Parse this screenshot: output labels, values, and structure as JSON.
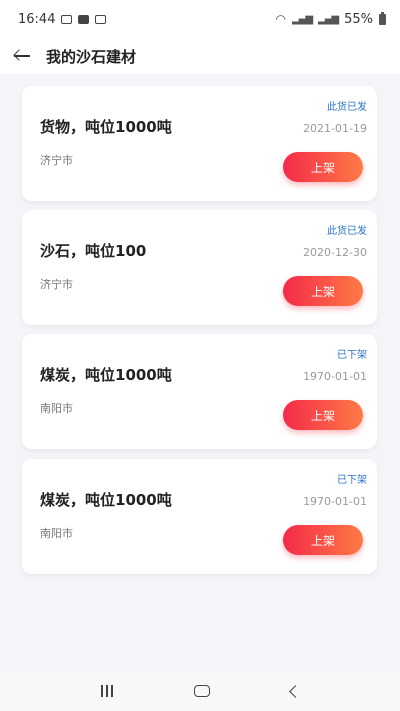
{
  "status_bar": {
    "time": "16:44",
    "battery": "55%"
  },
  "header": {
    "title": "我的沙石建材"
  },
  "items": [
    {
      "status": "此货已发",
      "title": "货物，吨位1000吨",
      "date": "2021-01-19",
      "city": "济宁市",
      "button_label": "上架"
    },
    {
      "status": "此货已发",
      "title": "沙石，吨位100",
      "date": "2020-12-30",
      "city": "济宁市",
      "button_label": "上架"
    },
    {
      "status": "已下架",
      "title": "煤炭，吨位1000吨",
      "date": "1970-01-01",
      "city": "南阳市",
      "button_label": "上架"
    },
    {
      "status": "已下架",
      "title": "煤炭，吨位1000吨",
      "date": "1970-01-01",
      "city": "南阳市",
      "button_label": "上架"
    }
  ],
  "colors": {
    "status_text": "#2a73c8",
    "button_gradient_start": "#f42a4a",
    "button_gradient_end": "#ff7a45",
    "background": "#f4f5f9"
  },
  "nav_bar": {
    "icons": [
      "recents-icon",
      "home-icon",
      "back-icon"
    ]
  }
}
